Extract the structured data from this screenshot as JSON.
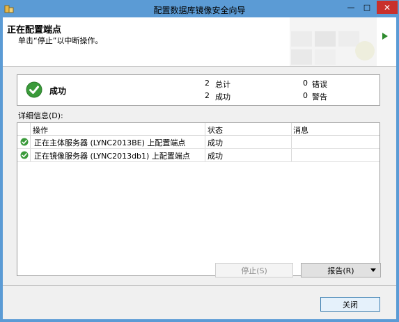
{
  "window": {
    "title": "配置数据库镜像安全向导"
  },
  "header": {
    "title": "正在配置端点",
    "subtitle": "单击“停止”以中断操作。"
  },
  "summary": {
    "status_label": "成功",
    "counts": [
      {
        "value": "2",
        "label": "总计"
      },
      {
        "value": "2",
        "label": "成功"
      },
      {
        "value": "0",
        "label": "错误"
      },
      {
        "value": "0",
        "label": "警告"
      }
    ]
  },
  "details": {
    "label": "详细信息(D):",
    "columns": [
      "操作",
      "状态",
      "消息"
    ],
    "rows": [
      {
        "operation": "正在主体服务器 (LYNC2013BE) 上配置端点",
        "status": "成功",
        "message": ""
      },
      {
        "operation": "正在镜像服务器 (LYNC2013db1) 上配置端点",
        "status": "成功",
        "message": ""
      }
    ]
  },
  "buttons": {
    "stop": "停止(S)",
    "report": "报告(R)",
    "close": "关闭"
  },
  "icons": {
    "app": "app-icon",
    "success": "success-check-icon"
  },
  "colors": {
    "title_bar": "#5b9bd5",
    "close_button": "#c9302c",
    "success": "#3a9a3a"
  }
}
